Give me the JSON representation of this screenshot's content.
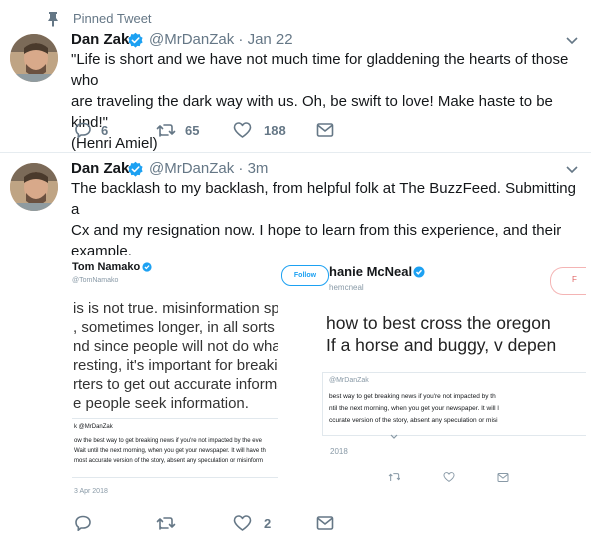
{
  "pinned": {
    "label": "Pinned Tweet"
  },
  "tweet1": {
    "name": "Dan Zak",
    "handle_time": "@MrDanZak · Jan 22",
    "lines": [
      "\"Life is short and we have not much time for gladdening the hearts of those who",
      "are traveling the dark way with us. Oh, be swift to love! Make haste to be kind!\"",
      "(Henri Amiel)"
    ],
    "replies": "6",
    "retweets": "65",
    "likes": "188"
  },
  "tweet2": {
    "name": "Dan Zak",
    "handle_time": "@MrDanZak · 3m",
    "lines": [
      "The backlash to my backlash, from helpful folk at The BuzzFeed. Submitting a",
      "Cx and my resignation now. I hope to learn from this experience, and their",
      "example."
    ],
    "likes": "2"
  },
  "media": {
    "left": {
      "name": "Tom Namako",
      "handle": "@TomNamako",
      "lines": [
        "is is not true. misinformation spread",
        ", sometimes longer, in all sorts of ou",
        "nd since people will not do what he's",
        "resting, it's important for breaking ne",
        "rters to get out accurate information",
        "e people seek information."
      ],
      "quote_handle": "k @MrDanZak",
      "quote_lines": [
        "ow the best way to get breaking news if you're not impacted by the eve",
        "Wait until the next morning, when you get your newspaper. It will have th",
        "most accurate version of the story, absent any speculation or misinform"
      ],
      "date": "3 Apr 2018"
    },
    "right": {
      "follow": "Follow",
      "name": "hanie McNeal",
      "handle": "hemcneal",
      "partial_button": "F",
      "lines": [
        "how to best cross the oregon",
        "If a horse and buggy, v depen"
      ],
      "quote_handle": "@MrDanZak",
      "quote_lines": [
        "best way to get breaking news if you're not impacted by th",
        "ntil the next morning, when you get your newspaper. It will l",
        "ccurate version of the story, absent any speculation or misi"
      ],
      "year": "2018"
    }
  },
  "colors": {
    "brand": "#1da1f2",
    "muted": "#657786",
    "divider": "#e6ecf0"
  }
}
